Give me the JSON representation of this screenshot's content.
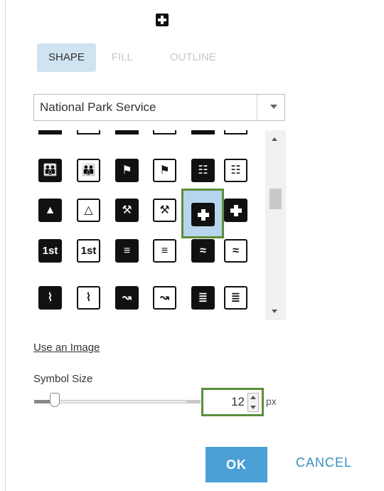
{
  "header": {
    "preview_icon": "first-aid-icon"
  },
  "tabs": [
    {
      "label": "SHAPE",
      "active": true
    },
    {
      "label": "FILL",
      "active": false
    },
    {
      "label": "OUTLINE",
      "active": false
    }
  ],
  "category_select": {
    "value": "National Park Service"
  },
  "symbol_grid": {
    "rows": [
      [
        "family-restroom-icon",
        "family-restroom-icon",
        "fire-extinguisher-icon",
        "fire-extinguisher-icon",
        "fire-grill-icon",
        "fire-grill-icon"
      ],
      [
        "firewood-icon",
        "firewood-icon",
        "axe-icon",
        "axe-icon",
        "first-aid-icon",
        "first-aid-icon"
      ],
      [
        "first-place-icon",
        "first-place-icon",
        "fish-icon",
        "fish-icon",
        "fish-school-icon",
        "fish-school-icon"
      ],
      [
        "fishing-icon",
        "fishing-icon",
        "fishing-rod-icon",
        "fishing-rod-icon",
        "fish-cleaning-icon",
        "fish-cleaning-icon"
      ]
    ],
    "first_place_text": "1st",
    "selected_symbol": "first-aid-icon"
  },
  "colors": {
    "selected_background": "#b7d6ee",
    "selected_border": "#5b8f3a",
    "accent": "#4aa0d5",
    "tab_active_background": "#cfe3f1"
  },
  "use_image_link": "Use an Image",
  "symbol_size": {
    "label": "Symbol Size",
    "value": "12",
    "unit": "px"
  },
  "actions": {
    "ok_label": "OK",
    "cancel_label": "CANCEL"
  }
}
